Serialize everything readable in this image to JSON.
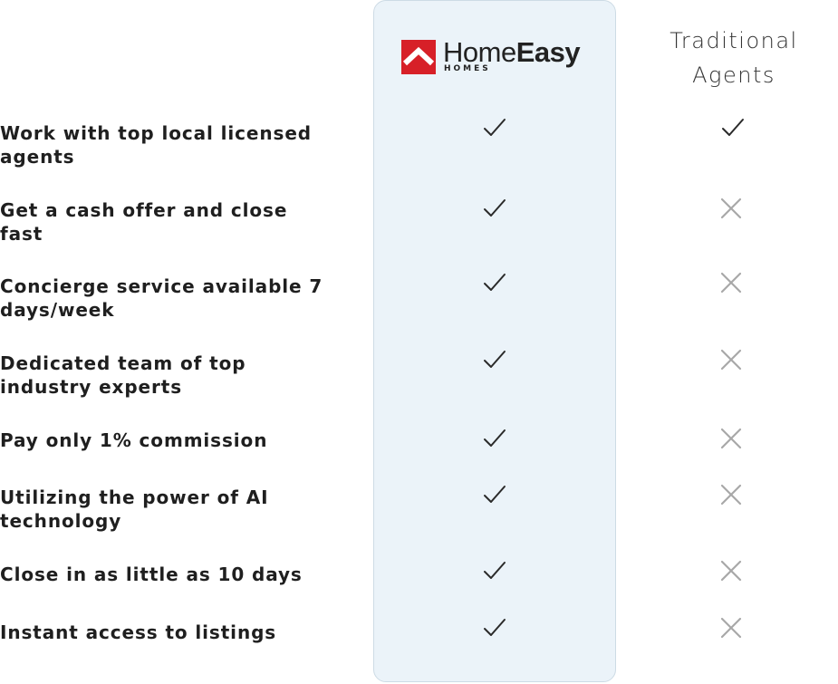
{
  "header": {
    "brand_word_light": "Home",
    "brand_word_bold": "Easy",
    "brand_sub": "HOMES",
    "traditional_line1": "Traditional",
    "traditional_line2": "Agents"
  },
  "colors": {
    "brand_red": "#d72028",
    "highlight_bg": "#ebf3f9",
    "check": "#2a2a2a",
    "cross": "#a8a8a8"
  },
  "icons": {
    "yes": "check-icon",
    "no": "x-icon"
  },
  "rows": [
    {
      "feature": "Work with top local licensed agents",
      "homeeasy": true,
      "traditional": true
    },
    {
      "feature": "Get a cash offer and close fast",
      "homeeasy": true,
      "traditional": false
    },
    {
      "feature": "Concierge service available 7 days/week",
      "homeeasy": true,
      "traditional": false
    },
    {
      "feature": "Dedicated team of top industry experts",
      "homeeasy": true,
      "traditional": false
    },
    {
      "feature": "Pay only 1% commission",
      "homeeasy": true,
      "traditional": false
    },
    {
      "feature": "Utilizing the power of AI technology",
      "homeeasy": true,
      "traditional": false
    },
    {
      "feature": "Close in as little as 10 days",
      "homeeasy": true,
      "traditional": false
    },
    {
      "feature": "Instant access to listings",
      "homeeasy": true,
      "traditional": false
    }
  ]
}
